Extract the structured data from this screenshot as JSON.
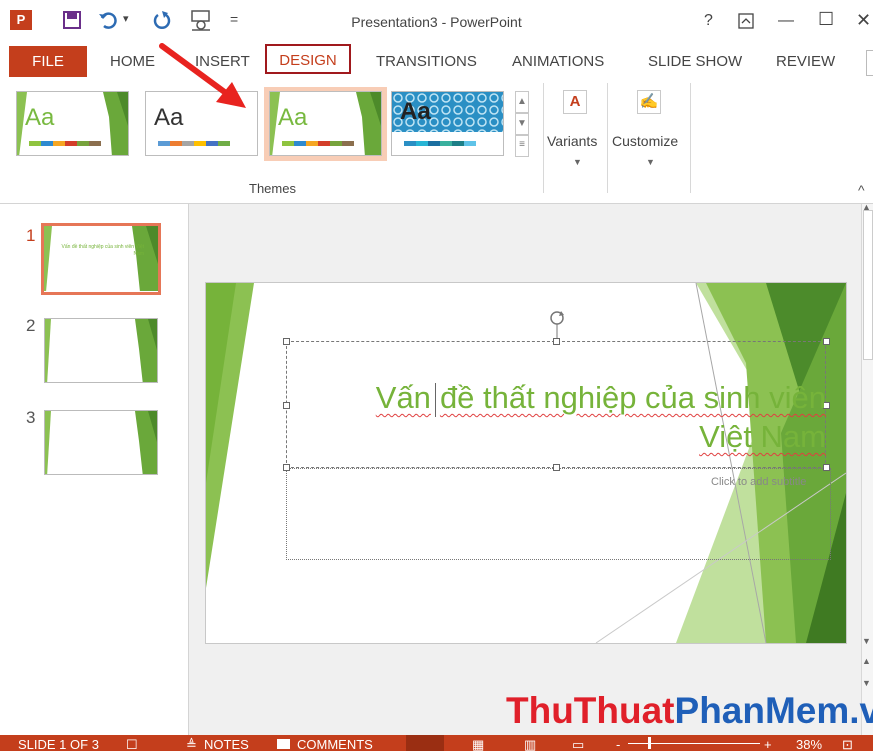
{
  "window": {
    "title": "Presentation3 - PowerPoint",
    "help": "?",
    "ribbon_display_icon": "ribbon-display-options-icon",
    "minimize": "—",
    "maximize": "☐",
    "close": "✕"
  },
  "qat": {
    "app_icon": "P",
    "undo_dropdown": "▾",
    "customize": "="
  },
  "tabs": [
    {
      "label": "FILE"
    },
    {
      "label": "HOME"
    },
    {
      "label": "INSERT"
    },
    {
      "label": "DESIGN"
    },
    {
      "label": "TRANSITIONS"
    },
    {
      "label": "ANIMATIONS"
    },
    {
      "label": "SLIDE SHOW"
    },
    {
      "label": "REVIEW"
    }
  ],
  "themes": {
    "group_label": "Themes",
    "items": [
      {
        "aa": "Aa",
        "color": "#78b940"
      },
      {
        "aa": "Aa",
        "color": "#333333"
      },
      {
        "aa": "Aa",
        "color": "#78b940"
      },
      {
        "aa": "Aa",
        "color": "#2b2b2b"
      }
    ]
  },
  "ribbon": {
    "variants_label": "Variants",
    "customize_label": "Customize",
    "collapse_glyph": "^"
  },
  "slides": {
    "numbers": [
      "1",
      "2",
      "3"
    ],
    "thumb1_text": "Vấn đề thất nghiệp của sinh viên Việt Nam"
  },
  "slide": {
    "title_line1_a": "Vấn",
    "title_line1_b": "đề thất nghiệp của sinh viên",
    "title_line2": "Việt Nam",
    "subtitle_placeholder": "Click to add subtitle"
  },
  "status": {
    "slide_info": "SLIDE 1 OF 3",
    "notes": "NOTES",
    "comments": "COMMENTS",
    "zoom": "38%"
  },
  "watermark": {
    "part1": "ThuThuat",
    "part2": "PhanMem",
    "part3": ".vn"
  },
  "colors": {
    "accent": "#c43e1c",
    "theme_green": "#76b33a",
    "arrow": "#e8231f",
    "watermark_red": "#e0202a",
    "watermark_blue": "#1f5fb8"
  }
}
